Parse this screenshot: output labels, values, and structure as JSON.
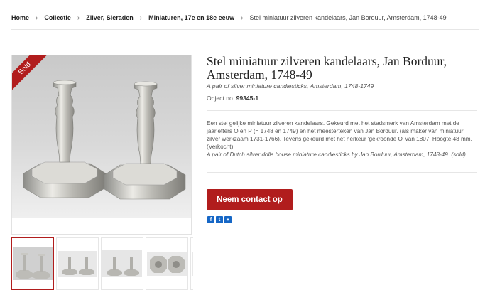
{
  "breadcrumb": {
    "items": [
      "Home",
      "Collectie",
      "Zilver, Sieraden",
      "Miniaturen, 17e en 18e eeuw"
    ],
    "current": "Stel miniatuur zilveren kandelaars, Jan Borduur, Amsterdam, 1748-49",
    "separator": "›"
  },
  "product": {
    "badge": "Sold",
    "title": "Stel miniatuur zilveren kandelaars, Jan Borduur, Amsterdam, 1748-49",
    "subtitle": "A pair of silver miniature candlesticks, Amsterdam, 1748-1749",
    "object_label": "Object no.",
    "object_no": "99345-1",
    "description_nl": "Een stel gelijke miniatuur zilveren kandelaars. Gekeurd met het stadsmerk van Amsterdam met de jaarletters O en P (= 1748 en 1749) en het meesterteken van Jan Borduur. (als maker van miniatuur zilver werkzaam 1731-1766). Tevens gekeurd met het herkeur 'gekroonde O' van 1807. Hoogte 48 mm. (Verkocht)",
    "description_en": "A pair of Dutch silver dolls house miniature candlesticks by Jan Borduur, Amsterdam, 1748-49. (sold)"
  },
  "actions": {
    "contact_label": "Neem contact op",
    "share": [
      {
        "icon": "facebook-icon",
        "glyph": "f"
      },
      {
        "icon": "twitter-icon",
        "glyph": "t"
      },
      {
        "icon": "share-plus-icon",
        "glyph": "+"
      }
    ]
  },
  "colors": {
    "accent": "#b11d1d",
    "share_blue": "#1667c6"
  }
}
